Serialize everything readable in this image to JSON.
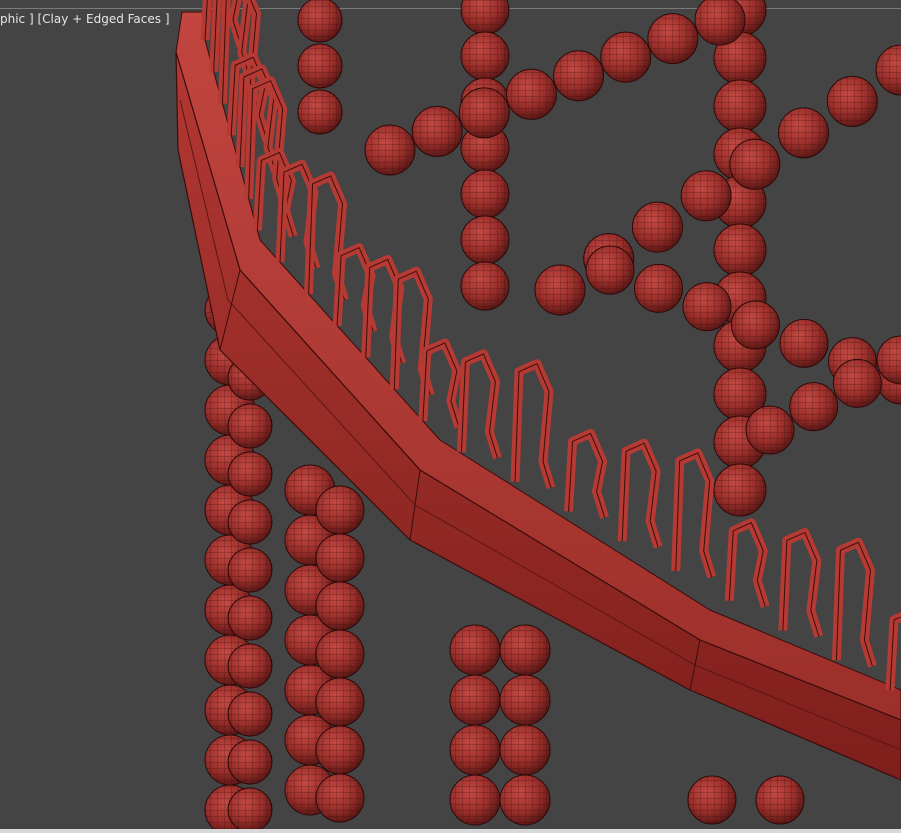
{
  "viewport": {
    "label": "phic ] [Clay + Edged Faces ]",
    "background": "#444444"
  },
  "model": {
    "color": "#a3312d",
    "edge_color": "#2a0a09"
  }
}
